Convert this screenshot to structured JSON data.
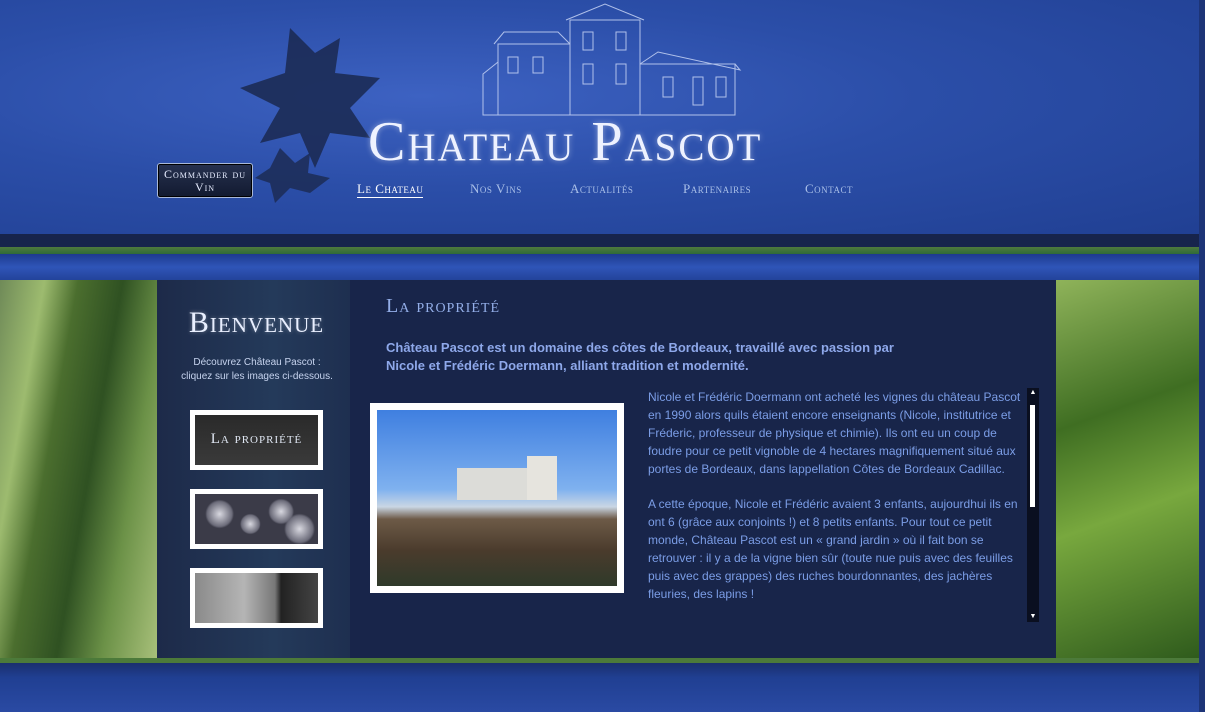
{
  "brand": {
    "logo": "Chateau Pascot"
  },
  "header": {
    "order_button": "Commander du Vin",
    "nav": [
      {
        "label": "Le Chateau",
        "active": true
      },
      {
        "label": "Nos Vins",
        "active": false
      },
      {
        "label": "Actualités",
        "active": false
      },
      {
        "label": "Partenaires",
        "active": false
      },
      {
        "label": "Contact",
        "active": false
      }
    ]
  },
  "sidebar": {
    "title": "Bienvenue",
    "intro_line1": "Découvrez Château Pascot :",
    "intro_line2": "cliquez sur les images ci-dessous.",
    "thumbs": [
      {
        "label": "La propriété"
      },
      {
        "label": ""
      },
      {
        "label": ""
      }
    ]
  },
  "content": {
    "title": "La propriété",
    "intro": "Château Pascot est un domaine des côtes de Bordeaux, travaillé avec passion par Nicole et Frédéric Doermann, alliant tradition et modernité.",
    "paragraphs": [
      "Nicole et Frédéric Doermann ont acheté les vignes du château Pascot en 1990 alors quils étaient encore enseignants (Nicole, institutrice et Fréderic, professeur de physique et chimie). Ils ont eu un coup de foudre pour ce petit vignoble de 4 hectares magnifiquement situé aux portes de Bordeaux, dans lappellation Côtes de Bordeaux Cadillac.",
      "A cette époque, Nicole et Frédéric avaient 3 enfants, aujourdhui ils en ont 6 (grâce aux conjoints !) et 8 petits enfants. Pour tout ce petit monde, Château Pascot est un « grand jardin »  où il fait bon se retrouver : il y a de la vigne bien sûr (toute nue puis avec des feuilles puis avec des grappes) des ruches bourdonnantes, des jachères fleuries, des lapins !"
    ]
  },
  "icons": {
    "scroll_up": "▲",
    "scroll_down": "▼"
  },
  "colors": {
    "header_blue": "#2b4ea8",
    "content_bg": "#18254a",
    "accent_green": "#4f7a3c",
    "text_blue": "#7b9de6"
  }
}
